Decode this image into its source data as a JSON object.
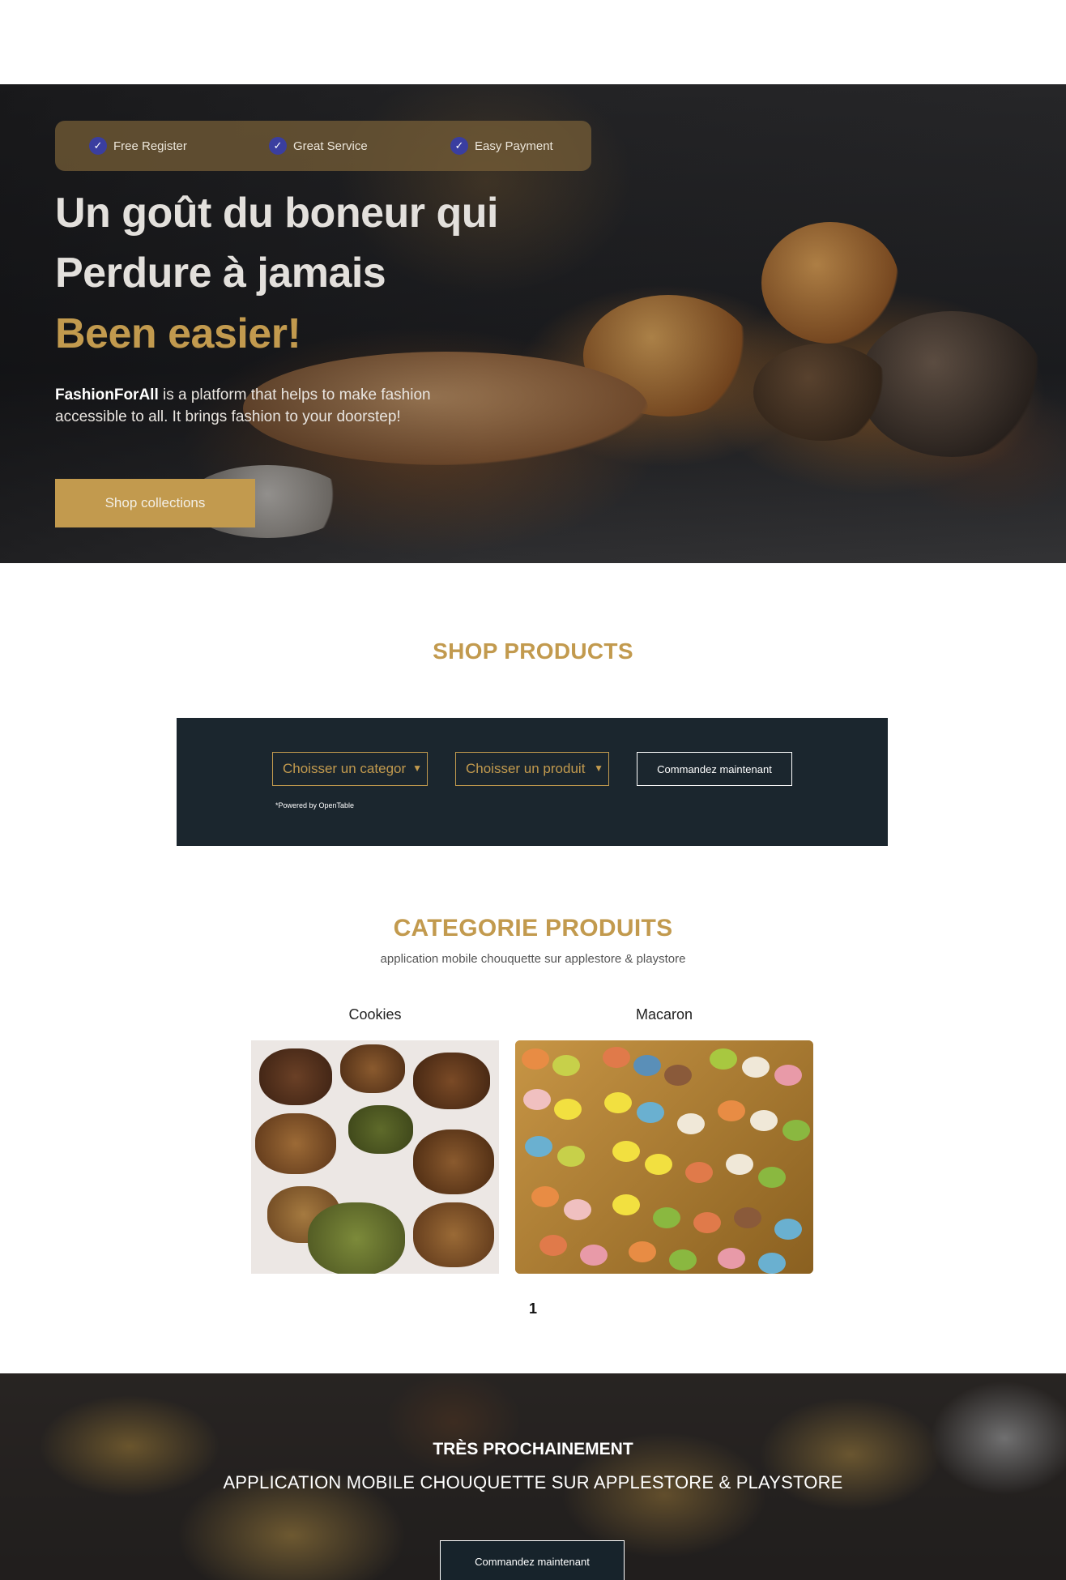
{
  "hero": {
    "badges": [
      "Free Register",
      "Great Service",
      "Easy Payment"
    ],
    "headline_line1": "Un goût du boneur qui",
    "headline_line2": "Perdure à jamais",
    "headline_accent": "Been easier!",
    "lead_brand": "FashionForAll",
    "lead_text": " is a platform that helps to make fashion accessible to all. It brings fashion to your doorstep!",
    "cta_label": "Shop collections",
    "accent_color": "#c29a4e"
  },
  "shop": {
    "title": "SHOP PRODUCTS",
    "category_select": "Choisser un categor",
    "product_select": "Choisser un produit",
    "order_button": "Commandez maintenant",
    "powered": "*Powered by OpenTable"
  },
  "categories": {
    "title": "CATEGORIE PRODUITS",
    "subtitle": "application mobile chouquette sur applestore & playstore",
    "items": [
      {
        "label": "Cookies"
      },
      {
        "label": "Macaron"
      }
    ],
    "page": "1"
  },
  "banner": {
    "title": "TRÈS PROCHAINEMENT",
    "subtitle": "APPLICATION MOBILE CHOUQUETTE SUR APPLESTORE & PLAYSTORE",
    "button": "Commandez maintenant"
  }
}
